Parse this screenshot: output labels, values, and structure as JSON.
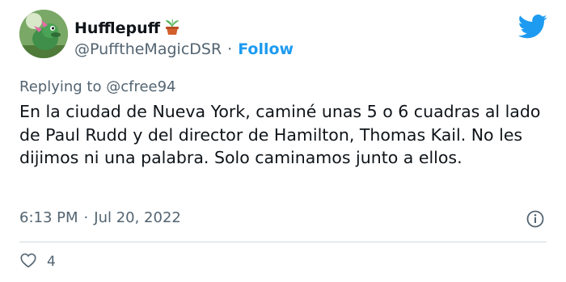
{
  "author": {
    "display_name": "Hufflepuff",
    "handle": "@PufftheMagicDSR",
    "separator": "·",
    "follow_label": "Follow"
  },
  "reply": {
    "prefix": "Replying to",
    "mention": "@cfree94"
  },
  "tweet": {
    "text": "En la ciudad de Nueva York, caminé unas 5 o 6 cuadras al lado de Paul Rudd y del director de Hamilton, Thomas Kail. No les dijimos ni una palabra. Solo caminamos junto a ellos."
  },
  "meta": {
    "time": "6:13 PM",
    "separator": "·",
    "date": "Jul 20, 2022"
  },
  "actions": {
    "like_count": "4"
  },
  "icons": {
    "brand": "twitter-bird-icon",
    "name_emoji": "potted-plant-icon",
    "info": "info-icon",
    "like": "heart-icon"
  },
  "colors": {
    "accent": "#1d9bf0",
    "secondary_text": "#536471",
    "divider": "#cfd9de"
  }
}
